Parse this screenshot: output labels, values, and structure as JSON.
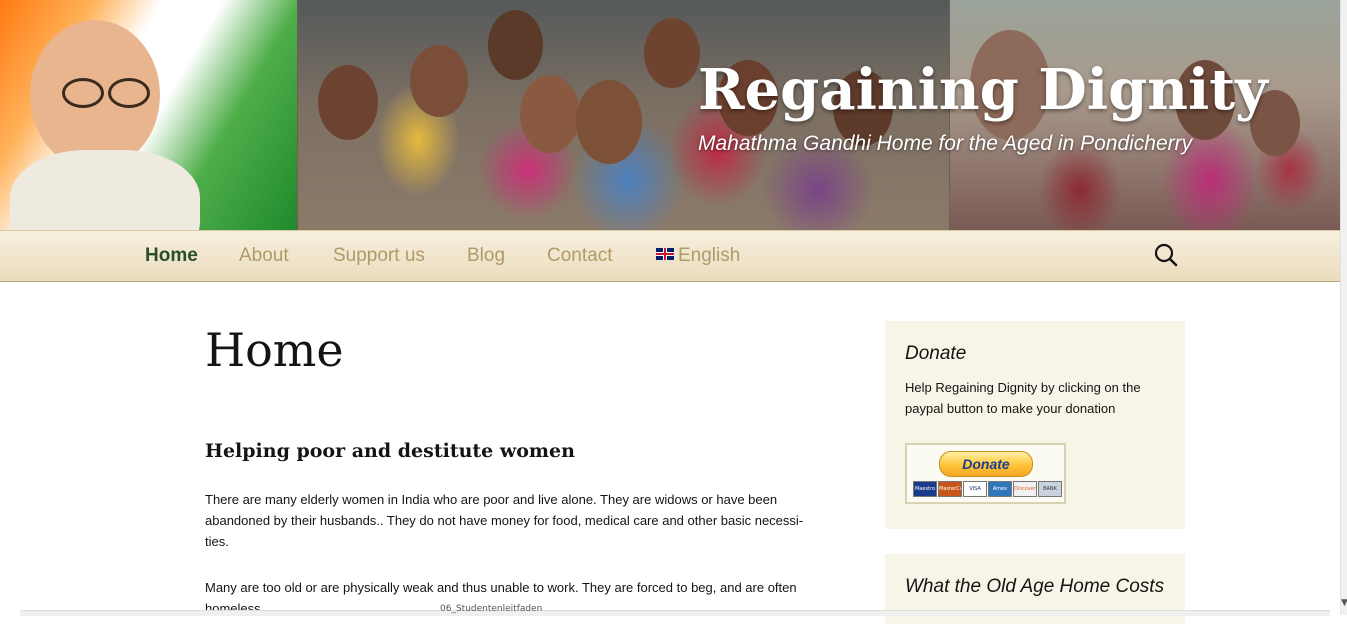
{
  "site": {
    "title": "Regaining Dignity",
    "description": "Mahathma Gandhi Home for the Aged in Pondicherry"
  },
  "nav": {
    "items": [
      {
        "label": "Home",
        "active": true
      },
      {
        "label": "About"
      },
      {
        "label": "Support us"
      },
      {
        "label": "Blog"
      },
      {
        "label": "Contact"
      },
      {
        "label": "English",
        "icon": "uk-flag-icon"
      }
    ],
    "search_icon": "search-icon"
  },
  "main": {
    "title": "Home",
    "subtitle": "Helping poor and destitute women",
    "paragraphs": [
      "There are many elderly women in India who are poor and live alone. They are widows or have been abandoned by their husbands.. They do not have money for food, medical care and other basic necessi-ties.",
      "Many are too old or are physically weak and thus unable to work. They are forced to beg, and are often homeless."
    ]
  },
  "sidebar": {
    "donate": {
      "title": "Donate",
      "text": "Help Regaining Dignity by clicking on the paypal button to make your donation",
      "button_label": "Donate",
      "cards": [
        "Maestro",
        "MasterCard",
        "VISA",
        "Amex",
        "Discover",
        "BANK"
      ]
    },
    "costs": {
      "title": "What the Old Age Home Costs"
    }
  },
  "bottom_bar": {
    "text": "06_Studentenleitfaden"
  },
  "colors": {
    "nav_active": "#2b4e2a",
    "nav_link": "#b09a6a",
    "nav_bg": "#f7f0df",
    "widget_bg": "#f7f5e7",
    "paypal_gold": "#ffc439"
  }
}
